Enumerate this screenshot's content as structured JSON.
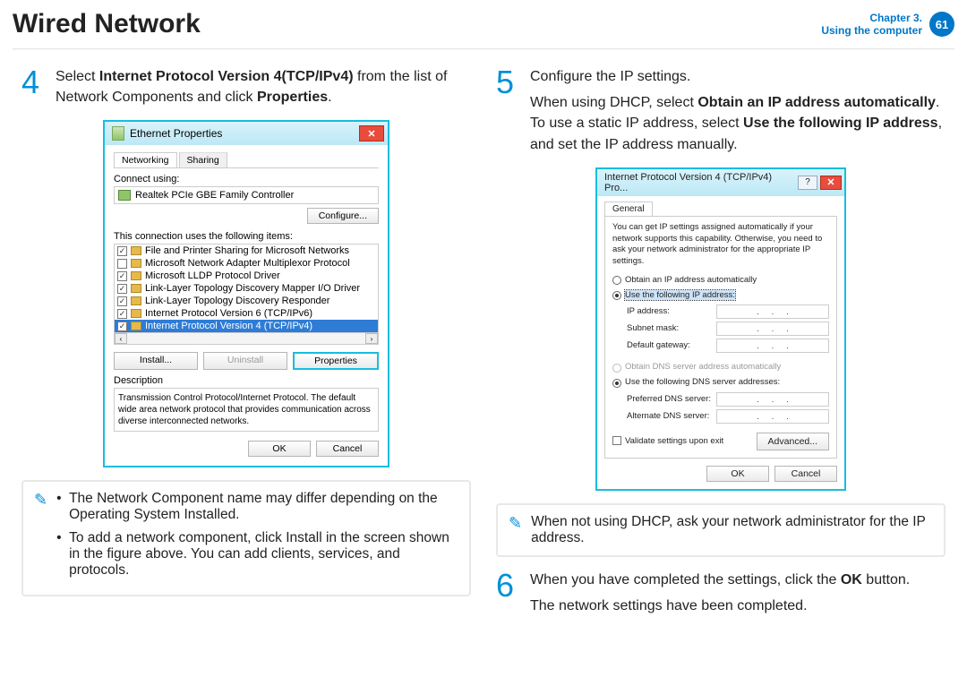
{
  "header": {
    "title": "Wired Network",
    "chapter_label": "Chapter 3.",
    "section_label": "Using the computer",
    "page_number": "61"
  },
  "left": {
    "step4_num": "4",
    "step4_a": "Select ",
    "step4_b": "Internet Protocol Version 4(TCP/IPv4)",
    "step4_c": " from the list of Network Components and click ",
    "step4_d": "Properties",
    "step4_e": ".",
    "note_items": {
      "n1": "The Network Component name may differ depending on the Operating System Installed.",
      "n2": "To add a network component, click Install in the screen shown in the figure above. You can add clients, services, and protocols."
    },
    "dlg1": {
      "title": "Ethernet Properties",
      "tab_networking": "Networking",
      "tab_sharing": "Sharing",
      "connect_using": "Connect using:",
      "nic": "Realtek PCIe GBE Family Controller",
      "configure_btn": "Configure...",
      "uses_items_label": "This connection uses the following items:",
      "items": {
        "i0": "File and Printer Sharing for Microsoft Networks",
        "i1": "Microsoft Network Adapter Multiplexor Protocol",
        "i2": "Microsoft LLDP Protocol Driver",
        "i3": "Link-Layer Topology Discovery Mapper I/O Driver",
        "i4": "Link-Layer Topology Discovery Responder",
        "i5": "Internet Protocol Version 6 (TCP/IPv6)",
        "i6": "Internet Protocol Version 4 (TCP/IPv4)"
      },
      "install_btn": "Install...",
      "uninstall_btn": "Uninstall",
      "properties_btn": "Properties",
      "description_label": "Description",
      "description_text": "Transmission Control Protocol/Internet Protocol. The default wide area network protocol that provides communication across diverse interconnected networks.",
      "ok_btn": "OK",
      "cancel_btn": "Cancel"
    }
  },
  "right": {
    "step5_num": "5",
    "step5_line1": "Configure the IP settings.",
    "step5_a": "When using DHCP, select ",
    "step5_b": "Obtain an IP address automatically",
    "step5_c": ". To use a static IP address, select ",
    "step5_d": "Use the following IP address",
    "step5_e": ", and set the IP address manually.",
    "note2": "When not using DHCP, ask your network administrator for the IP address.",
    "step6_num": "6",
    "step6_a": "When you have completed the settings, click the ",
    "step6_b": "OK",
    "step6_c": " button.",
    "step6_line2": "The network settings have been completed.",
    "dlg2": {
      "title": "Internet Protocol Version 4 (TCP/IPv4) Pro...",
      "help": "?",
      "tab_general": "General",
      "intro": "You can get IP settings assigned automatically if your network supports this capability. Otherwise, you need to ask your network administrator for the appropriate IP settings.",
      "r_obtain_ip": "Obtain an IP address automatically",
      "r_use_ip": "Use the following IP address:",
      "lbl_ip": "IP address:",
      "lbl_subnet": "Subnet mask:",
      "lbl_gateway": "Default gateway:",
      "r_obtain_dns": "Obtain DNS server address automatically",
      "r_use_dns": "Use the following DNS server addresses:",
      "lbl_pref_dns": "Preferred DNS server:",
      "lbl_alt_dns": "Alternate DNS server:",
      "validate": "Validate settings upon exit",
      "advanced_btn": "Advanced...",
      "ok_btn": "OK",
      "cancel_btn": "Cancel"
    }
  }
}
